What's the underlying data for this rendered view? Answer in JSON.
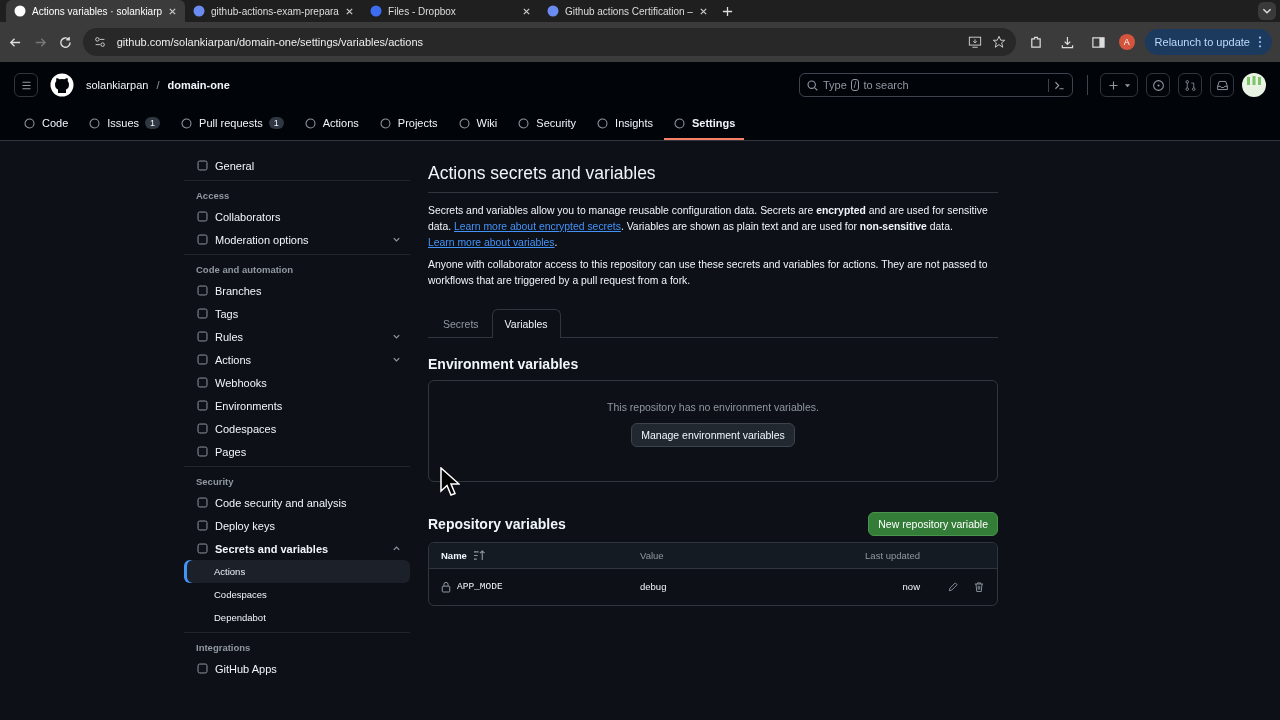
{
  "browser": {
    "tabs": [
      {
        "title": "Actions variables · solankiarp",
        "selected": true
      },
      {
        "title": "github-actions-exam-prepara",
        "selected": false
      },
      {
        "title": "Files - Dropbox",
        "selected": false
      },
      {
        "title": "Github actions Certification –",
        "selected": false
      }
    ],
    "url": "github.com/solankiarpan/domain-one/settings/variables/actions",
    "profile": "A",
    "relaunch": "Relaunch to update"
  },
  "header": {
    "owner": "solankiarpan",
    "separator": "/",
    "repo": "domain-one",
    "search_prefix": "Type",
    "search_key": "/",
    "search_suffix": "to search"
  },
  "repo_nav": [
    {
      "label": "Code",
      "selected": false
    },
    {
      "label": "Issues",
      "count": "1",
      "selected": false
    },
    {
      "label": "Pull requests",
      "count": "1",
      "selected": false
    },
    {
      "label": "Actions",
      "selected": false
    },
    {
      "label": "Projects",
      "selected": false
    },
    {
      "label": "Wiki",
      "selected": false
    },
    {
      "label": "Security",
      "selected": false
    },
    {
      "label": "Insights",
      "selected": false
    },
    {
      "label": "Settings",
      "selected": true
    }
  ],
  "sidebar": [
    {
      "items": [
        {
          "label": "General",
          "selected": false
        }
      ]
    },
    {
      "heading": "Access",
      "items": [
        {
          "label": "Collaborators",
          "selected": false
        },
        {
          "label": "Moderation options",
          "selected": false,
          "expanded": false
        }
      ]
    },
    {
      "heading": "Code and automation",
      "items": [
        {
          "label": "Branches",
          "selected": false
        },
        {
          "label": "Tags",
          "selected": false
        },
        {
          "label": "Rules",
          "selected": false,
          "expanded": false
        },
        {
          "label": "Actions",
          "selected": false,
          "expanded": false
        },
        {
          "label": "Webhooks",
          "selected": false
        },
        {
          "label": "Environments",
          "selected": false
        },
        {
          "label": "Codespaces",
          "selected": false
        },
        {
          "label": "Pages",
          "selected": false
        }
      ]
    },
    {
      "heading": "Security",
      "items": [
        {
          "label": "Code security and analysis",
          "selected": false
        },
        {
          "label": "Deploy keys",
          "selected": false
        },
        {
          "label": "Secrets and variables",
          "selected": false,
          "expanded": true,
          "children": [
            {
              "label": "Actions",
              "selected": true
            },
            {
              "label": "Codespaces",
              "selected": false
            },
            {
              "label": "Dependabot",
              "selected": false
            }
          ]
        }
      ]
    },
    {
      "heading": "Integrations",
      "items": [
        {
          "label": "GitHub Apps",
          "selected": false
        }
      ]
    }
  ],
  "main": {
    "title": "Actions secrets and variables",
    "paragraphs": [
      [
        {
          "text": "Secrets and variables allow you to manage reusable configuration data. Secrets are **encrypted** and are used for sensitive data. "
        },
        {
          "link": "Learn more about encrypted secrets"
        },
        {
          "text": ". Variables are shown as plain text and are used for **non-sensitive** data. "
        },
        {
          "link": "Learn more about variables"
        },
        {
          "text": "."
        }
      ],
      [
        {
          "text": "Anyone with collaborator access to this repository can use these secrets and variables for actions. They are not passed to workflows that are triggered by a pull request from a fork."
        }
      ]
    ],
    "tabs": [
      {
        "label": "Secrets",
        "selected": false
      },
      {
        "label": "Variables",
        "selected": true
      }
    ],
    "environment": {
      "title": "Environment variables",
      "empty": "This repository has no environment variables.",
      "button": "Manage environment variables"
    },
    "repository": {
      "title": "Repository variables",
      "new_button": "New repository variable",
      "columns": [
        "Name",
        "Value",
        "Last updated"
      ],
      "rows": [
        {
          "name": "APP_MODE",
          "value": "debug",
          "updated": "now"
        }
      ]
    }
  }
}
